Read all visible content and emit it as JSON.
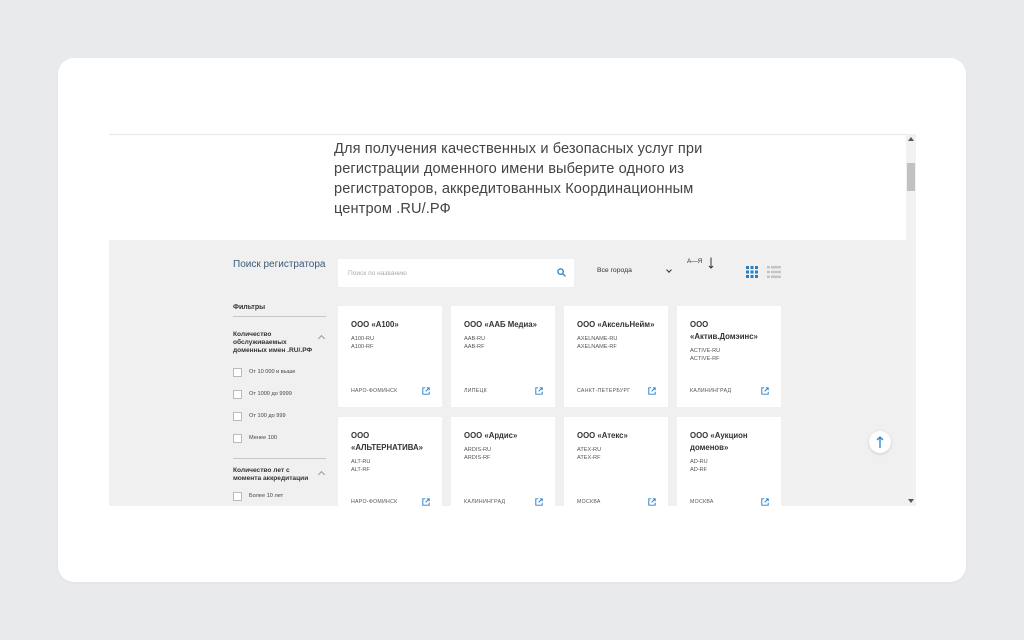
{
  "intro_text": "Для получения качественных и безопасных услуг при регистрации доменного имени выберите одного из регистраторов, аккредитованных Координационным центром .RU/.РФ",
  "sidebar": {
    "title": "Поиск регистратора",
    "filters_label": "Фильтры",
    "groups": [
      {
        "title": "Количество обслуживаемых доменных имен .RU/.РФ",
        "options": [
          "От 10 000 и выше",
          "От 1000 до 9999",
          "От 100 до 999",
          "Менее 100"
        ]
      },
      {
        "title": "Количество лет с момента аккредитации",
        "options": [
          "Более 10 лет"
        ]
      }
    ]
  },
  "search": {
    "placeholder": "Поиск по названию",
    "icon": "search-icon"
  },
  "city_select": {
    "selected": "Все города"
  },
  "sort": {
    "label": "А—Я"
  },
  "colors": {
    "accent": "#2a7fc4",
    "content_bg": "#f0f0f0",
    "title_blue": "#3b5a78"
  },
  "cards": [
    {
      "name": "ООО «А100»",
      "domains": [
        "A100-RU",
        "A100-RF"
      ],
      "city": "НАРО-ФОМИНСК"
    },
    {
      "name": "ООО «ААБ Медиа»",
      "domains": [
        "AAB-RU",
        "AAB-RF"
      ],
      "city": "ЛИПЕЦК"
    },
    {
      "name": "ООО «АксельНейм»",
      "domains": [
        "AXELNAME-RU",
        "AXELNAME-RF"
      ],
      "city": "САНКТ-ПЕТЕРБУРГ"
    },
    {
      "name": "ООО «Актив.Домэинс»",
      "domains": [
        "ACTIVE-RU",
        "ACTIVE-RF"
      ],
      "city": "КАЛИНИНГРАД"
    },
    {
      "name": "ООО «АЛЬТЕРНАТИВА»",
      "domains": [
        "ALT-RU",
        "ALT-RF"
      ],
      "city": "НАРО-ФОМИНСК"
    },
    {
      "name": "ООО «Ардис»",
      "domains": [
        "ARDIS-RU",
        "ARDIS-RF"
      ],
      "city": "КАЛИНИНГРАД"
    },
    {
      "name": "ООО «Атекс»",
      "domains": [
        "ATEX-RU",
        "ATEX-RF"
      ],
      "city": "МОСКВА"
    },
    {
      "name": "ООО «Аукцион доменов»",
      "domains": [
        "AD-RU",
        "AD-RF"
      ],
      "city": "МОСКВА"
    }
  ]
}
